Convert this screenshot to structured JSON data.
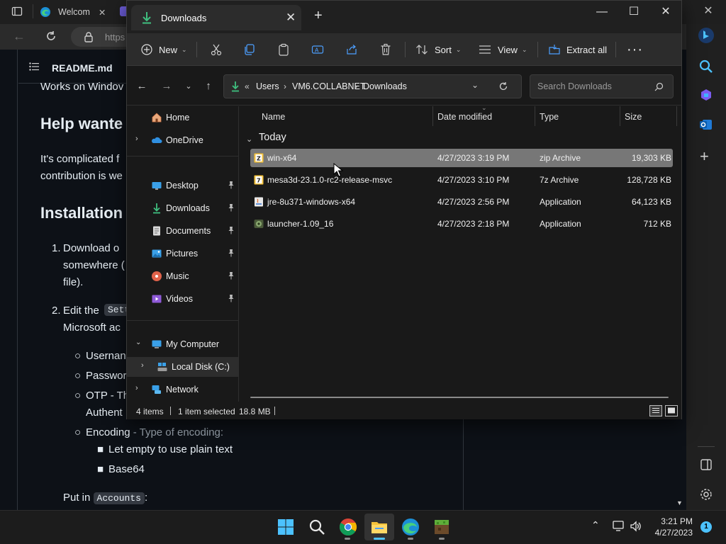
{
  "browser": {
    "tab_title": "Welcom",
    "address_prefix": "https",
    "readme_title": "README.md",
    "content": {
      "line_works": "Works on Windov",
      "h_help": "Help wante",
      "p_help_1": "It's complicated f",
      "p_help_2": "contribution is we",
      "h_install": "Installation",
      "li1_a": "Download o",
      "li1_b": "somewhere (",
      "li1_c": "file).",
      "li2_a": "Edit the",
      "li2_code": "Sett",
      "li2_b": "Microsoft ac",
      "sub1": "Usernan",
      "sub2": "Passwor",
      "sub3_a": "OTP - Th",
      "sub3_b": "Authent",
      "sub4_a": "Encoding",
      "sub4_b": " - Type of encoding:",
      "sub4_i1": "Let empty to use plain text",
      "sub4_i2": "Base64",
      "put_in": "Put in",
      "put_code": "Accounts",
      "put_colon": ":"
    }
  },
  "explorer": {
    "tab_title": "Downloads",
    "commands": {
      "new": "New",
      "sort": "Sort",
      "view": "View",
      "extract_all": "Extract all"
    },
    "address": {
      "sep": "«",
      "seg1": "Users",
      "seg2": "VM6.COLLABNET",
      "seg3": "Downloads"
    },
    "search_placeholder": "Search Downloads",
    "nav": {
      "home": "Home",
      "onedrive": "OneDrive",
      "desktop": "Desktop",
      "downloads": "Downloads",
      "documents": "Documents",
      "pictures": "Pictures",
      "music": "Music",
      "videos": "Videos",
      "my_computer": "My Computer",
      "local_disk": "Local Disk (C:)",
      "network": "Network"
    },
    "columns": {
      "name": "Name",
      "date": "Date modified",
      "type": "Type",
      "size": "Size"
    },
    "group": "Today",
    "files": [
      {
        "name": "win-x64",
        "date": "4/27/2023 3:19 PM",
        "type": "zip Archive",
        "size": "19,303 KB"
      },
      {
        "name": "mesa3d-23.1.0-rc2-release-msvc",
        "date": "4/27/2023 3:10 PM",
        "type": "7z Archive",
        "size": "128,728 KB"
      },
      {
        "name": "jre-8u371-windows-x64",
        "date": "4/27/2023 2:56 PM",
        "type": "Application",
        "size": "64,123 KB"
      },
      {
        "name": "launcher-1.09_16",
        "date": "4/27/2023 2:18 PM",
        "type": "Application",
        "size": "712 KB"
      }
    ],
    "status": {
      "items": "4 items",
      "selected": "1 item selected",
      "size": "18.8 MB"
    }
  },
  "taskbar": {
    "time": "3:21 PM",
    "date": "4/27/2023",
    "notifications": "1"
  },
  "colors": {
    "explorer_bg": "#191919",
    "selected_row": "#777777",
    "accent_blue": "#4cc2ff",
    "folder_yellow": "#f5c33b",
    "download_green": "#3fbf7f"
  }
}
